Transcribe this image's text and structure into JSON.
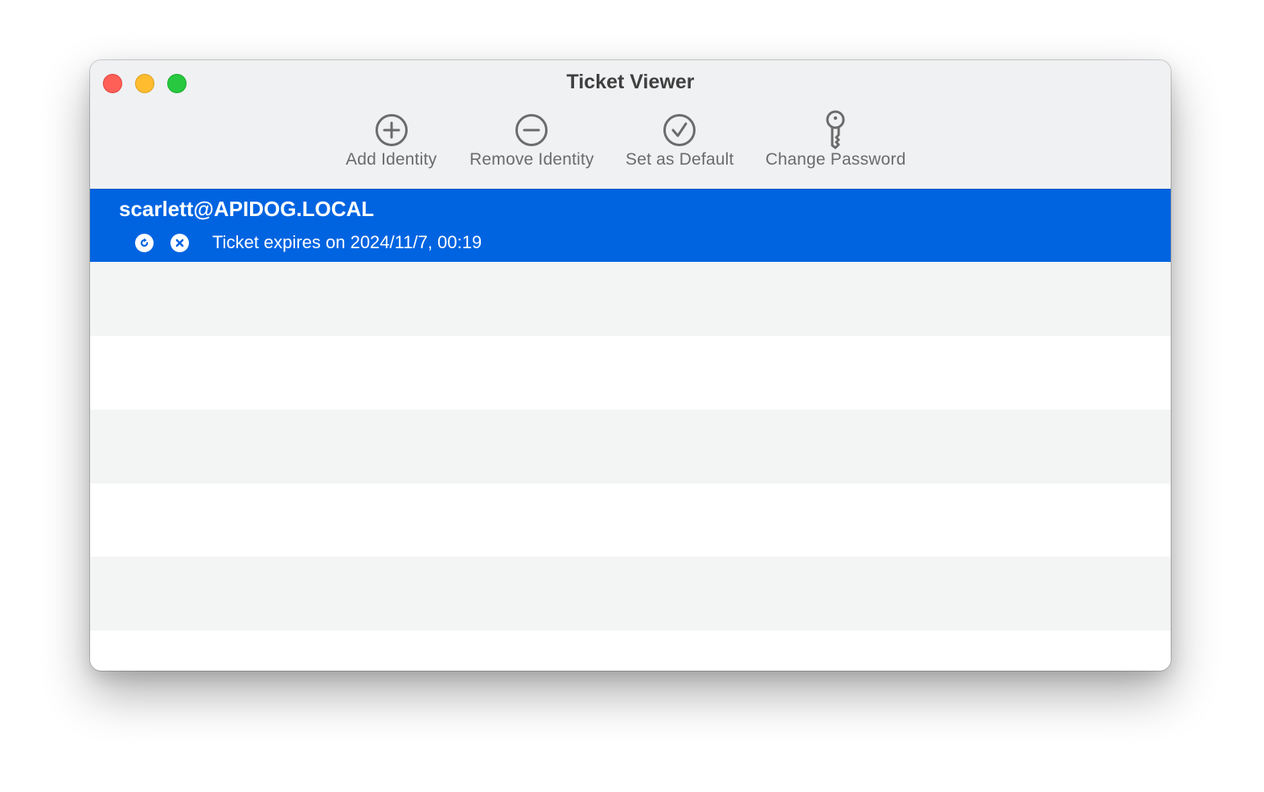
{
  "window": {
    "title": "Ticket Viewer",
    "controls": [
      "close",
      "minimize",
      "zoom"
    ]
  },
  "toolbar": {
    "items": [
      {
        "label": "Add Identity",
        "icon": "plus-circle-icon"
      },
      {
        "label": "Remove Identity",
        "icon": "minus-circle-icon"
      },
      {
        "label": "Set as Default",
        "icon": "checkmark-circle-icon"
      },
      {
        "label": "Change Password",
        "icon": "key-icon"
      }
    ]
  },
  "identities": [
    {
      "principal": "scarlett@APIDOG.LOCAL",
      "selected": true,
      "ticket_status": "Ticket expires on 2024/11/7, 00:19",
      "actions": [
        {
          "icon": "renew-icon"
        },
        {
          "icon": "destroy-ticket-icon"
        }
      ]
    }
  ],
  "colors": {
    "selection": "#0064e1",
    "stripe": "#f3f4f4",
    "toolbar_bg": "#f0f1f3",
    "toolbar_text": "#6b6b6b"
  }
}
